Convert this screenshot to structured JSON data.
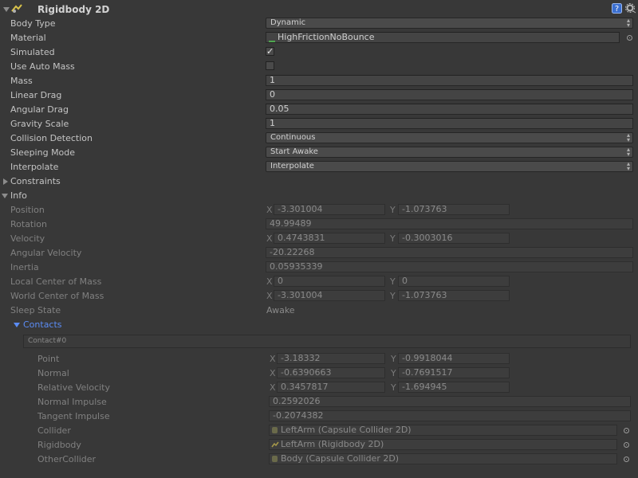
{
  "component": {
    "title": "Rigidbody 2D",
    "icon": "rigidbody2d-icon"
  },
  "header_icons": [
    "help-icon",
    "gear-icon"
  ],
  "fields": {
    "body_type": {
      "label": "Body Type",
      "value": "Dynamic"
    },
    "material": {
      "label": "Material",
      "value": "HighFrictionNoBounce"
    },
    "simulated": {
      "label": "Simulated",
      "checked": true
    },
    "use_auto_mass": {
      "label": "Use Auto Mass",
      "checked": false
    },
    "mass": {
      "label": "Mass",
      "value": "1"
    },
    "linear_drag": {
      "label": "Linear Drag",
      "value": "0"
    },
    "angular_drag": {
      "label": "Angular Drag",
      "value": "0.05"
    },
    "gravity_scale": {
      "label": "Gravity Scale",
      "value": "1"
    },
    "collision_detection": {
      "label": "Collision Detection",
      "value": "Continuous"
    },
    "sleeping_mode": {
      "label": "Sleeping Mode",
      "value": "Start Awake"
    },
    "interpolate": {
      "label": "Interpolate",
      "value": "Interpolate"
    },
    "constraints": {
      "label": "Constraints"
    }
  },
  "info": {
    "label": "Info",
    "position": {
      "label": "Position",
      "x": "-3.301004",
      "y": "-1.073763"
    },
    "rotation": {
      "label": "Rotation",
      "value": "49.99489"
    },
    "velocity": {
      "label": "Velocity",
      "x": "0.4743831",
      "y": "-0.3003016"
    },
    "angular_velocity": {
      "label": "Angular Velocity",
      "value": "-20.22268"
    },
    "inertia": {
      "label": "Inertia",
      "value": "0.05935339"
    },
    "local_center_of_mass": {
      "label": "Local Center of Mass",
      "x": "0",
      "y": "0"
    },
    "world_center_of_mass": {
      "label": "World Center of Mass",
      "x": "-3.301004",
      "y": "-1.073763"
    },
    "sleep_state": {
      "label": "Sleep State",
      "value": "Awake"
    },
    "contacts": {
      "label": "Contacts",
      "contact_title": "Contact#0",
      "point": {
        "label": "Point",
        "x": "-3.18332",
        "y": "-0.9918044"
      },
      "normal": {
        "label": "Normal",
        "x": "-0.6390663",
        "y": "-0.7691517"
      },
      "relative_velocity": {
        "label": "Relative Velocity",
        "x": "0.3457817",
        "y": "-1.694945"
      },
      "normal_impulse": {
        "label": "Normal Impulse",
        "value": "0.2592026"
      },
      "tangent_impulse": {
        "label": "Tangent Impulse",
        "value": "-0.2074382"
      },
      "collider": {
        "label": "Collider",
        "value": "LeftArm (Capsule Collider 2D)"
      },
      "rigidbody": {
        "label": "Rigidbody",
        "value": "LeftArm (Rigidbody 2D)"
      },
      "other_collider": {
        "label": "OtherCollider",
        "value": "Body (Capsule Collider 2D)"
      }
    }
  },
  "axis_labels": {
    "x": "X",
    "y": "Y"
  },
  "colors": {
    "background": "#383838",
    "accent": "#5b8cf5",
    "help_icon": "#3b6fd0"
  }
}
